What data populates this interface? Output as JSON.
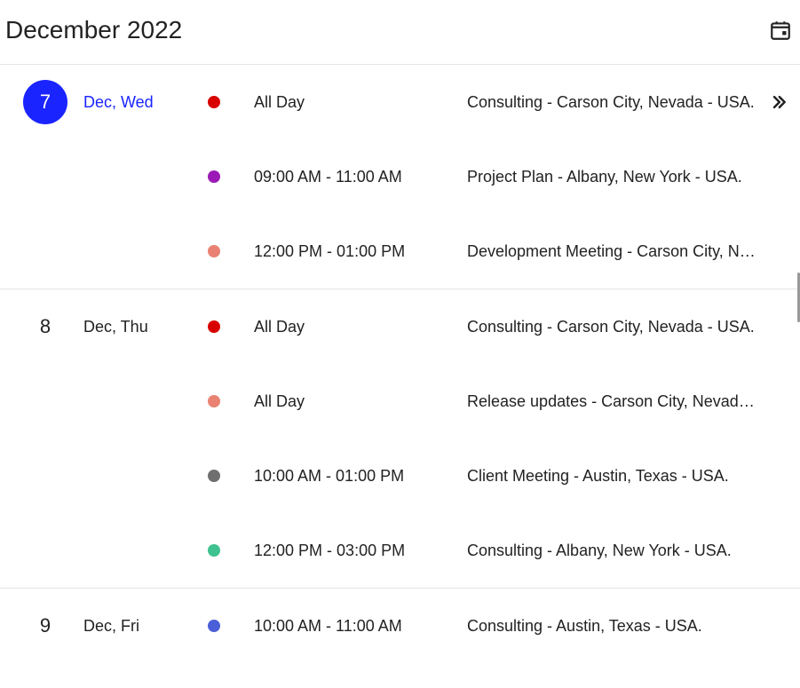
{
  "header": {
    "title": "December 2022"
  },
  "colors": {
    "red": "#d90000",
    "purple": "#9b1ab6",
    "salmon": "#e98272",
    "grey": "#6f6f6f",
    "green": "#3ec28f",
    "blue": "#4a5fd8",
    "today": "#1a24ff"
  },
  "days": [
    {
      "num": "7",
      "dow": "Dec, Wed",
      "today": true,
      "events": [
        {
          "color": "red",
          "time": "All Day",
          "title": "Consulting - Carson City, Nevada - USA.",
          "hasArrow": true
        },
        {
          "color": "purple",
          "time": "09:00 AM - 11:00 AM",
          "title": "Project Plan - Albany, New York - USA."
        },
        {
          "color": "salmon",
          "time": "12:00 PM - 01:00 PM",
          "title": "Development Meeting - Carson City, Nevada .."
        }
      ]
    },
    {
      "num": "8",
      "dow": "Dec, Thu",
      "today": false,
      "events": [
        {
          "color": "red",
          "time": "All Day",
          "title": "Consulting - Carson City, Nevada - USA."
        },
        {
          "color": "salmon",
          "time": "All Day",
          "title": "Release updates - Carson City, Nevada - USA."
        },
        {
          "color": "grey",
          "time": "10:00 AM - 01:00 PM",
          "title": "Client Meeting - Austin, Texas - USA."
        },
        {
          "color": "green",
          "time": "12:00 PM - 03:00 PM",
          "title": "Consulting - Albany, New York - USA."
        }
      ]
    },
    {
      "num": "9",
      "dow": "Dec, Fri",
      "today": false,
      "events": [
        {
          "color": "blue",
          "time": "10:00 AM - 11:00 AM",
          "title": "Consulting - Austin, Texas - USA."
        }
      ]
    }
  ]
}
